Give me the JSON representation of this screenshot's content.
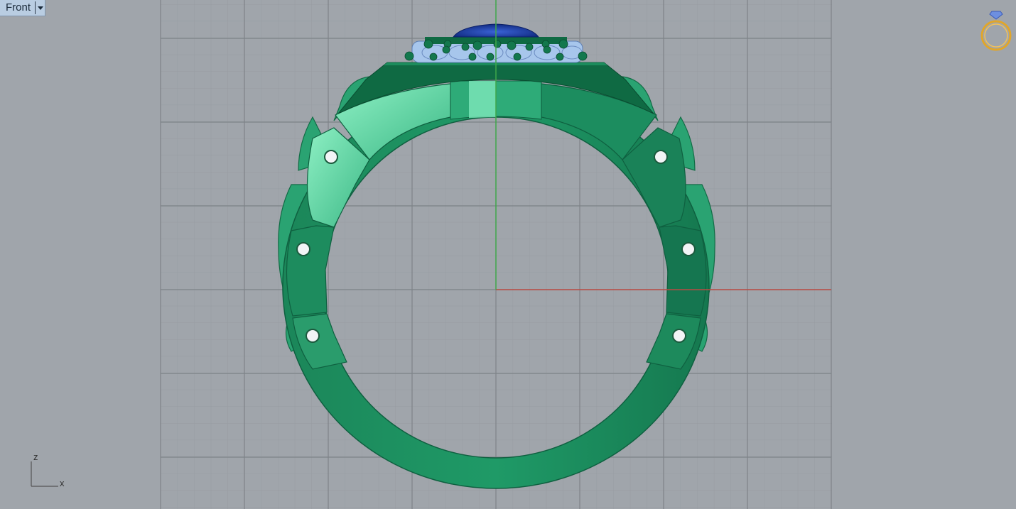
{
  "viewport": {
    "name": "Front",
    "axes": {
      "z_label": "z",
      "x_label": "x"
    }
  },
  "colors": {
    "background": "#a0a5ab",
    "grid_minor": "#979ca2",
    "grid_major": "#7e8388",
    "x_axis": "#b94a43",
    "z_axis": "#3fa64a",
    "metal": "#1b8f5e",
    "metal_light": "#79e6b7",
    "stone": "#1f3fae",
    "pave": "#a7c6ec"
  },
  "icons": {
    "ring_nav": "ring-icon"
  }
}
